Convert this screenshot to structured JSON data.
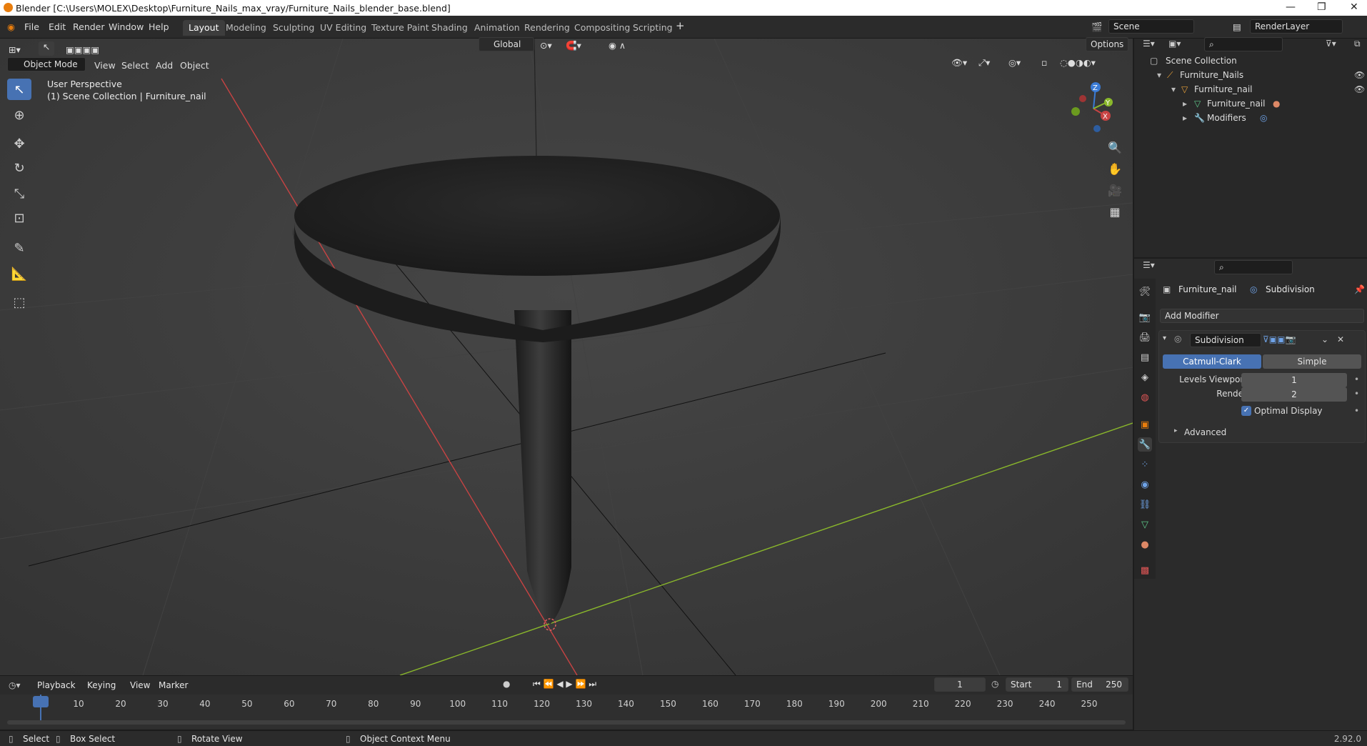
{
  "window": {
    "title": "Blender [C:\\Users\\MOLEX\\Desktop\\Furniture_Nails_max_vray/Furniture_Nails_blender_base.blend]"
  },
  "menu": {
    "file": "File",
    "edit": "Edit",
    "render": "Render",
    "window": "Window",
    "help": "Help"
  },
  "workspaces": [
    "Layout",
    "Modeling",
    "Sculpting",
    "UV Editing",
    "Texture Paint",
    "Shading",
    "Animation",
    "Rendering",
    "Compositing",
    "Scripting"
  ],
  "scene": {
    "name": "Scene",
    "render_layer": "RenderLayer"
  },
  "viewport": {
    "mode": "Object Mode",
    "view": "View",
    "select": "Select",
    "add": "Add",
    "object": "Object",
    "orientation": "Global",
    "options": "Options",
    "perspective": "User Perspective",
    "collection_info": "(1) Scene Collection | Furniture_nail",
    "gizmo": {
      "x": "X",
      "y": "Y",
      "z": "Z"
    }
  },
  "outliner": {
    "root": "Scene Collection",
    "items": [
      "Furniture_Nails",
      "Furniture_nail",
      "Furniture_nail",
      "Modifiers"
    ]
  },
  "properties": {
    "object_name": "Furniture_nail",
    "modifier_label": "Subdivision",
    "add_modifier": "Add Modifier",
    "modifier": {
      "name": "Subdivision",
      "type_a": "Catmull-Clark",
      "type_b": "Simple",
      "levels_viewport_label": "Levels Viewport",
      "levels_viewport": "1",
      "render_label": "Render",
      "render": "2",
      "optimal_display": "Optimal Display",
      "advanced": "Advanced"
    }
  },
  "timeline": {
    "playback": "Playback",
    "keying": "Keying",
    "view": "View",
    "marker": "Marker",
    "current_frame": "1",
    "start_label": "Start",
    "start": "1",
    "end_label": "End",
    "end": "250",
    "ticks": [
      "1",
      "10",
      "20",
      "30",
      "40",
      "50",
      "60",
      "70",
      "80",
      "90",
      "100",
      "110",
      "120",
      "130",
      "140",
      "150",
      "160",
      "170",
      "180",
      "190",
      "200",
      "210",
      "220",
      "230",
      "240",
      "250"
    ]
  },
  "status": {
    "select": "Select",
    "box_select": "Box Select",
    "rotate_view": "Rotate View",
    "context_menu": "Object Context Menu",
    "version": "2.92.0"
  },
  "colors": {
    "accent": "#4772b3",
    "orange": "#e87d0d",
    "x_axis": "#c84343",
    "y_axis": "#8ab82b"
  }
}
